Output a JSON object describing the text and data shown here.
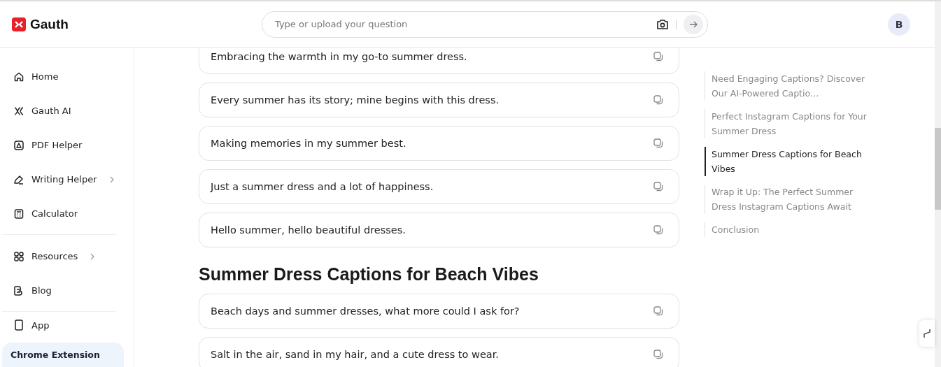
{
  "brand": "Gauth",
  "search": {
    "placeholder": "Type or upload your question"
  },
  "avatar": "B",
  "nav_groups": [
    [
      {
        "label": "Home",
        "arrow": false
      },
      {
        "label": "Gauth AI",
        "arrow": false
      },
      {
        "label": "PDF Helper",
        "arrow": false
      },
      {
        "label": "Writing Helper",
        "arrow": true
      },
      {
        "label": "Calculator",
        "arrow": false
      }
    ],
    [
      {
        "label": "Resources",
        "arrow": true
      },
      {
        "label": "Blog",
        "arrow": false
      }
    ],
    [
      {
        "label": "App",
        "arrow": false
      }
    ]
  ],
  "promo": "Chrome Extension",
  "content": [
    {
      "kind": "caption",
      "text": "Embracing the warmth in my go-to summer dress."
    },
    {
      "kind": "caption",
      "text": "Every summer has its story; mine begins with this dress."
    },
    {
      "kind": "caption",
      "text": "Making memories in my summer best."
    },
    {
      "kind": "caption",
      "text": "Just a summer dress and a lot of happiness."
    },
    {
      "kind": "caption",
      "text": "Hello summer, hello beautiful dresses."
    },
    {
      "kind": "heading",
      "text": "Summer Dress Captions for Beach Vibes"
    },
    {
      "kind": "caption",
      "text": "Beach days and summer dresses, what more could I ask for?"
    },
    {
      "kind": "caption",
      "text": "Salt in the air, sand in my hair, and a cute dress to wear."
    }
  ],
  "toc": [
    {
      "text": "Need Engaging Captions? Discover Our AI-Powered Captio…",
      "selected": false
    },
    {
      "text": "Perfect Instagram Captions for Your Summer Dress",
      "selected": false
    },
    {
      "text": "Summer Dress Captions for Beach Vibes",
      "selected": true
    },
    {
      "text": "Wrap it Up: The Perfect Summer Dress Instagram Captions Await",
      "selected": false
    },
    {
      "text": "Conclusion",
      "selected": false
    }
  ]
}
